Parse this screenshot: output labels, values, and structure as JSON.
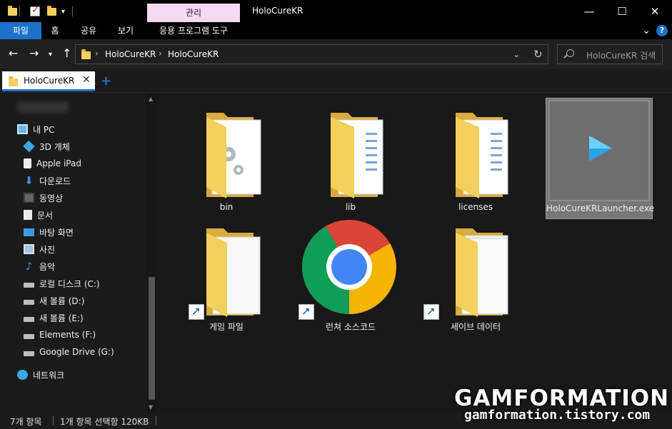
{
  "window": {
    "context_tab": "관리",
    "title": "HoloCureKR",
    "minimize": "—",
    "maximize": "☐",
    "close": "✕"
  },
  "ribbon": {
    "tabs": [
      {
        "label": "파일"
      },
      {
        "label": "홈"
      },
      {
        "label": "공유"
      },
      {
        "label": "보기"
      },
      {
        "label": "응용 프로그램 도구"
      }
    ],
    "collapse": "⌄",
    "help": "?"
  },
  "address": {
    "crumbs": [
      "HoloCureKR",
      "HoloCureKR"
    ],
    "separator": "›",
    "search_placeholder": "HoloCureKR 검색"
  },
  "tabs": {
    "active": "HoloCureKR",
    "close": "✕",
    "add": "+"
  },
  "sidebar": {
    "this_pc": "내 PC",
    "items": [
      {
        "label": "3D 개체"
      },
      {
        "label": "Apple iPad"
      },
      {
        "label": "다운로드"
      },
      {
        "label": "동영상"
      },
      {
        "label": "문서"
      },
      {
        "label": "바탕 화면"
      },
      {
        "label": "사진"
      },
      {
        "label": "음악"
      },
      {
        "label": "로컬 디스크 (C:)"
      },
      {
        "label": "새 볼륨 (D:)"
      },
      {
        "label": "새 볼륨 (E:)"
      },
      {
        "label": "Elements (F:)"
      },
      {
        "label": "Google Drive (G:)"
      }
    ],
    "network": "네트워크"
  },
  "files": [
    {
      "name": "bin"
    },
    {
      "name": "lib"
    },
    {
      "name": "licenses"
    },
    {
      "name": "HoloCureKRLauncher.exe"
    },
    {
      "name": "게임 파일"
    },
    {
      "name": "런쳐 소스코드"
    },
    {
      "name": "세이브 데이터"
    }
  ],
  "status": {
    "count": "7개 항목",
    "selection": "1개 항목 선택함 120KB"
  },
  "watermark": {
    "title": "GAMFORMATION",
    "url": "gamformation.tistory.com"
  },
  "colors": {
    "accent": "#1a73c9",
    "context_tab": "#f6d9f3",
    "folder": "#f3cf5d"
  }
}
